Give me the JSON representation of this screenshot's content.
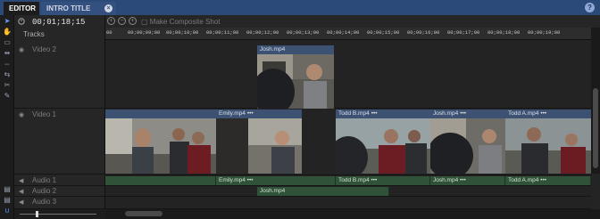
{
  "tabs": [
    {
      "label": "EDITOR"
    },
    {
      "label": "INTRO TITLE CARD",
      "close_glyph": "×"
    }
  ],
  "help_glyph": "?",
  "timecode": "00;01;18;15",
  "tracks_label": "Tracks",
  "toolbar": {
    "composite_label": "Make Composite Shot"
  },
  "ruler_ticks": [
    "00",
    "00;00;09;00",
    "00;00;10;00",
    "00;00;11;00",
    "00;00;12;00",
    "00;00;13;00",
    "00;00;14;00",
    "00;00;15;00",
    "00;00;16;00",
    "00;00;17;00",
    "00;00;18;00",
    "00;00;19;00"
  ],
  "tracks": {
    "video2": {
      "name": "Video 2"
    },
    "video1": {
      "name": "Video 1"
    },
    "audio1": {
      "name": "Audio 1"
    },
    "audio2": {
      "name": "Audio 2"
    },
    "audio3": {
      "name": "Audio 3"
    }
  },
  "video2_clips": [
    {
      "label": "Josh.mp4"
    }
  ],
  "video1_clips": [
    {
      "label": "Emily.mp4",
      "menu": "•••"
    },
    {
      "label": "Todd B.mp4",
      "menu": "•••"
    },
    {
      "label": "Josh.mp4",
      "menu": "•••"
    },
    {
      "label": "Todd A.mp4",
      "menu": "•••"
    }
  ],
  "audio1_clips": [
    {
      "label": "Emily.mp4 •••"
    },
    {
      "label": "Todd B.mp4 •••"
    },
    {
      "label": "Josh.mp4 •••"
    },
    {
      "label": "Todd A.mp4 •••"
    }
  ],
  "audio2_clips": [
    {
      "label": "Josh.mp4"
    }
  ],
  "colors": {
    "tabbar": "#2b4a7a",
    "video_clip_header": "#3d5272",
    "audio_clip": "#305238"
  }
}
